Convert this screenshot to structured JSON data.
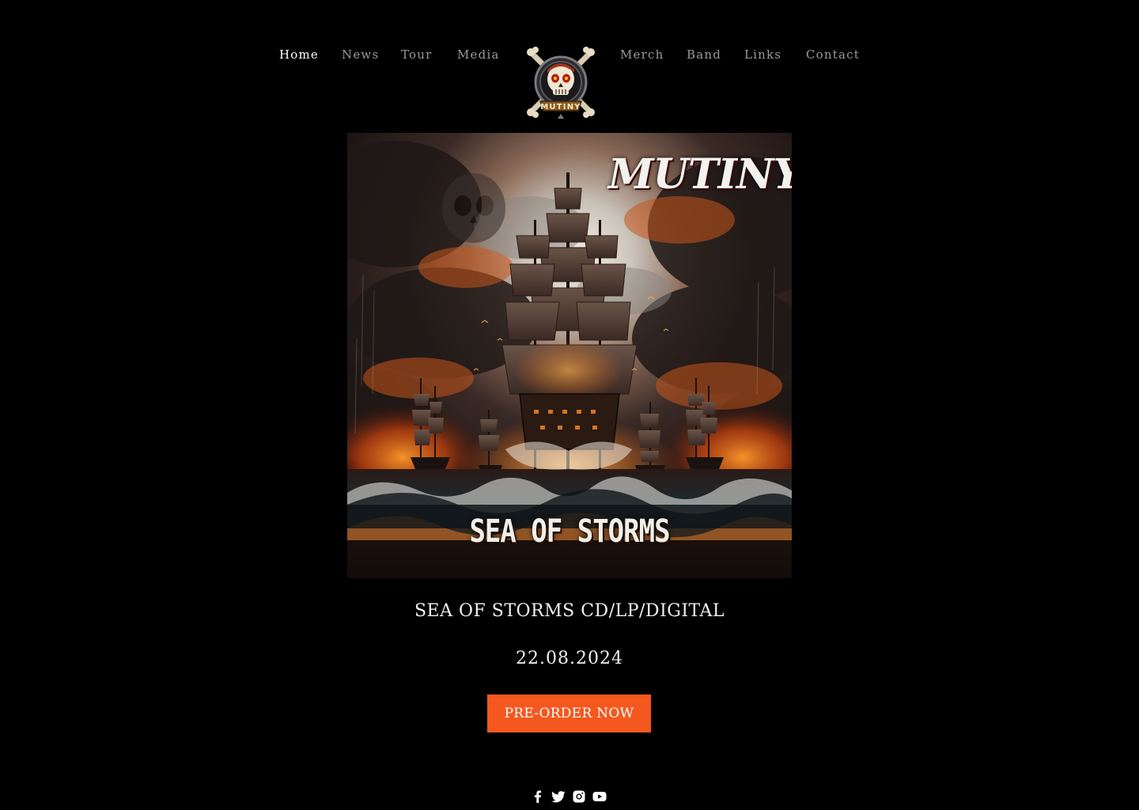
{
  "nav": {
    "left_items": [
      {
        "label": "Home",
        "active": true
      },
      {
        "label": "News",
        "active": false
      },
      {
        "label": "Tour",
        "active": false
      },
      {
        "label": "Media",
        "active": false
      }
    ],
    "right_items": [
      {
        "label": "Merch",
        "active": false
      },
      {
        "label": "Band",
        "active": false
      },
      {
        "label": "Links",
        "active": false
      },
      {
        "label": "Contact",
        "active": false
      }
    ],
    "logo": {
      "icon": "skull-crossbones-logo",
      "text": "MUTINY"
    }
  },
  "hero": {
    "cover": {
      "band_text": "MUTINY",
      "album_text": "SEA OF STORMS"
    },
    "release_title": "SEA OF STORMS CD/LP/DIGITAL",
    "release_date": "22.08.2024",
    "cta_label": "PRE-ORDER NOW"
  },
  "social": [
    {
      "icon": "facebook-icon"
    },
    {
      "icon": "twitter-icon"
    },
    {
      "icon": "instagram-icon"
    },
    {
      "icon": "youtube-icon"
    }
  ],
  "colors": {
    "background": "#000000",
    "nav_text": "#9a9a9a",
    "nav_active": "#ffffff",
    "accent": "#f5581f"
  }
}
